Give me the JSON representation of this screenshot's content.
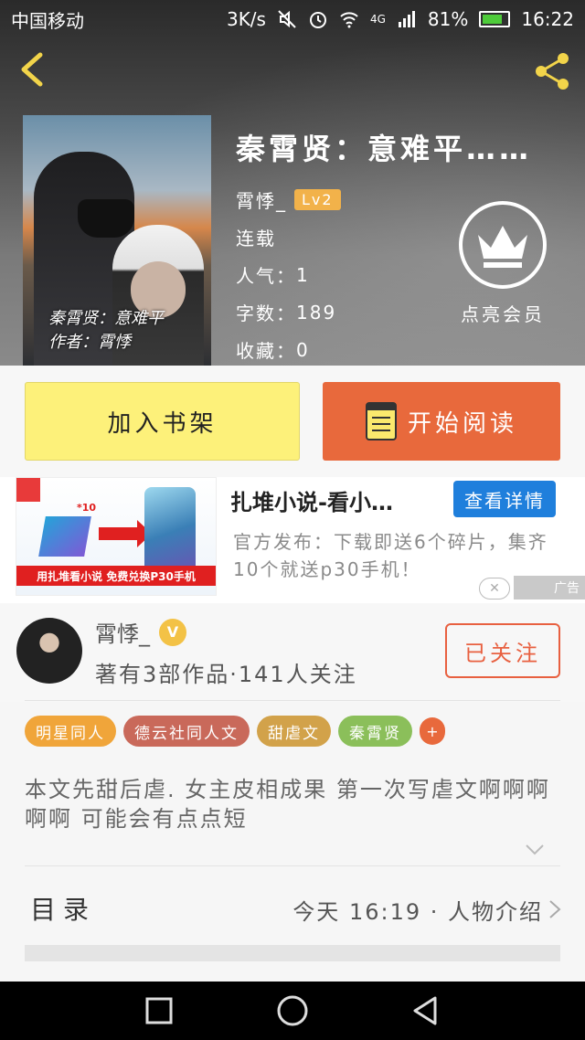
{
  "status_bar": {
    "carrier": "中国移动",
    "speed": "3K/s",
    "network": "4G",
    "battery": "81%",
    "time": "16:22"
  },
  "book": {
    "title": "秦霄贤：意难平……",
    "author": "霄悸_",
    "level": "Lv2",
    "status": "连载",
    "popularity_label": "人气：",
    "popularity": "1",
    "word_count_label": "字数：",
    "word_count": "189",
    "favorites_label": "收藏：",
    "favorites": "0",
    "cover_line1": "秦霄贤：意难平",
    "cover_line2": "作者：霄悸"
  },
  "vip": {
    "label": "点亮会员"
  },
  "actions": {
    "add_shelf": "加入书架",
    "start_read": "开始阅读"
  },
  "ad": {
    "title": "扎堆小说-看小…",
    "detail_button": "查看详情",
    "description": "官方发布：下载即送6个碎片，集齐10个就送p30手机！",
    "banner_text": "用扎堆看小说 免费兑换P30手机",
    "badge_count": "*10",
    "close": "✕",
    "tag": "广告"
  },
  "author_section": {
    "name": "霄悸_",
    "v_badge": "V",
    "stats": "著有3部作品·141人关注",
    "follow_button": "已关注"
  },
  "tags": [
    {
      "label": "明星同人",
      "color": "#f0a53a"
    },
    {
      "label": "德云社同人文",
      "color": "#c9695a"
    },
    {
      "label": "甜虐文",
      "color": "#d2a24a"
    },
    {
      "label": "秦霄贤",
      "color": "#8bbf5a"
    }
  ],
  "tag_more": "+",
  "description": "本文先甜后虐. 女主皮相成果  第一次写虐文啊啊啊啊啊  可能会有点点短",
  "catalog": {
    "label": "目录",
    "latest": "今天 16:19 · 人物介绍"
  },
  "colors": {
    "shelf_button": "#fdf17a",
    "read_button": "#e8693c",
    "follow": "#e86040",
    "ad_button": "#1f7fdc"
  }
}
